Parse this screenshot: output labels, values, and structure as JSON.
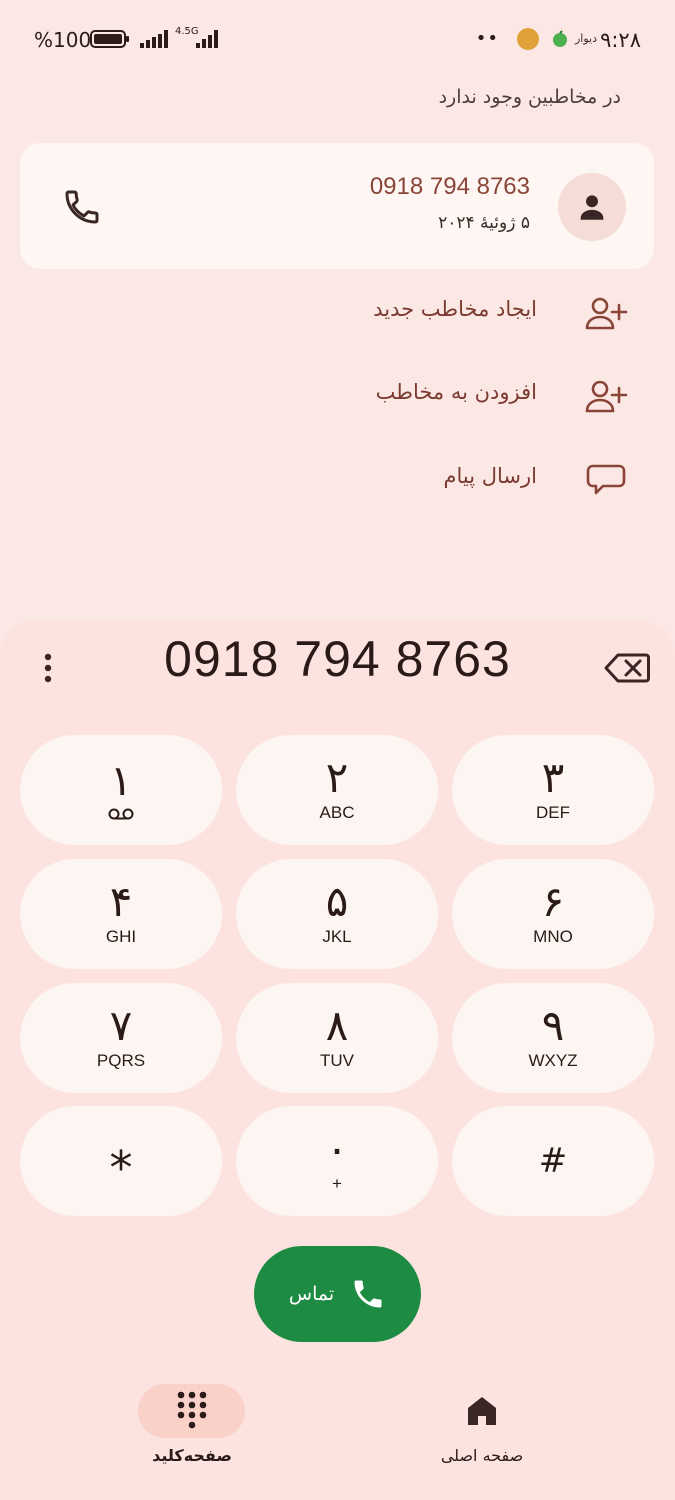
{
  "status_bar": {
    "time": "۹:۲۸",
    "app_text": "دیوار",
    "dots": "••",
    "battery_percent": "%100",
    "network": "4.5G"
  },
  "header": {
    "not_in_contacts": "در مخاطبین وجود ندارد"
  },
  "suggestion": {
    "number": "0918 794 8763",
    "date": "۵ ژوئیهٔ ۲۰۲۴"
  },
  "actions": [
    {
      "label": "ایجاد مخاطب جدید",
      "icon": "add-person-icon"
    },
    {
      "label": "افزودن به مخاطب",
      "icon": "add-person-icon"
    },
    {
      "label": "ارسال پیام",
      "icon": "message-bubble-icon"
    }
  ],
  "dialer": {
    "number": "0918 794 8763",
    "keys": [
      {
        "digit": "۱",
        "letters": ""
      },
      {
        "digit": "۲",
        "letters": "ABC"
      },
      {
        "digit": "۳",
        "letters": "DEF"
      },
      {
        "digit": "۴",
        "letters": "GHI"
      },
      {
        "digit": "۵",
        "letters": "JKL"
      },
      {
        "digit": "۶",
        "letters": "MNO"
      },
      {
        "digit": "۷",
        "letters": "PQRS"
      },
      {
        "digit": "۸",
        "letters": "TUV"
      },
      {
        "digit": "۹",
        "letters": "WXYZ"
      },
      {
        "digit": "*",
        "letters": ""
      },
      {
        "digit": "۰",
        "letters": "+"
      },
      {
        "digit": "#",
        "letters": ""
      }
    ],
    "call_label": "تماس"
  },
  "nav": {
    "keypad_label": "صفحه‌کلید",
    "home_label": "صفحه اصلی"
  },
  "colors": {
    "background": "#fbe8e4",
    "card": "#fdf6f3",
    "accent_text": "#7c3b31",
    "call_green": "#1e8b43",
    "nav_pill": "#f9d1c9"
  }
}
